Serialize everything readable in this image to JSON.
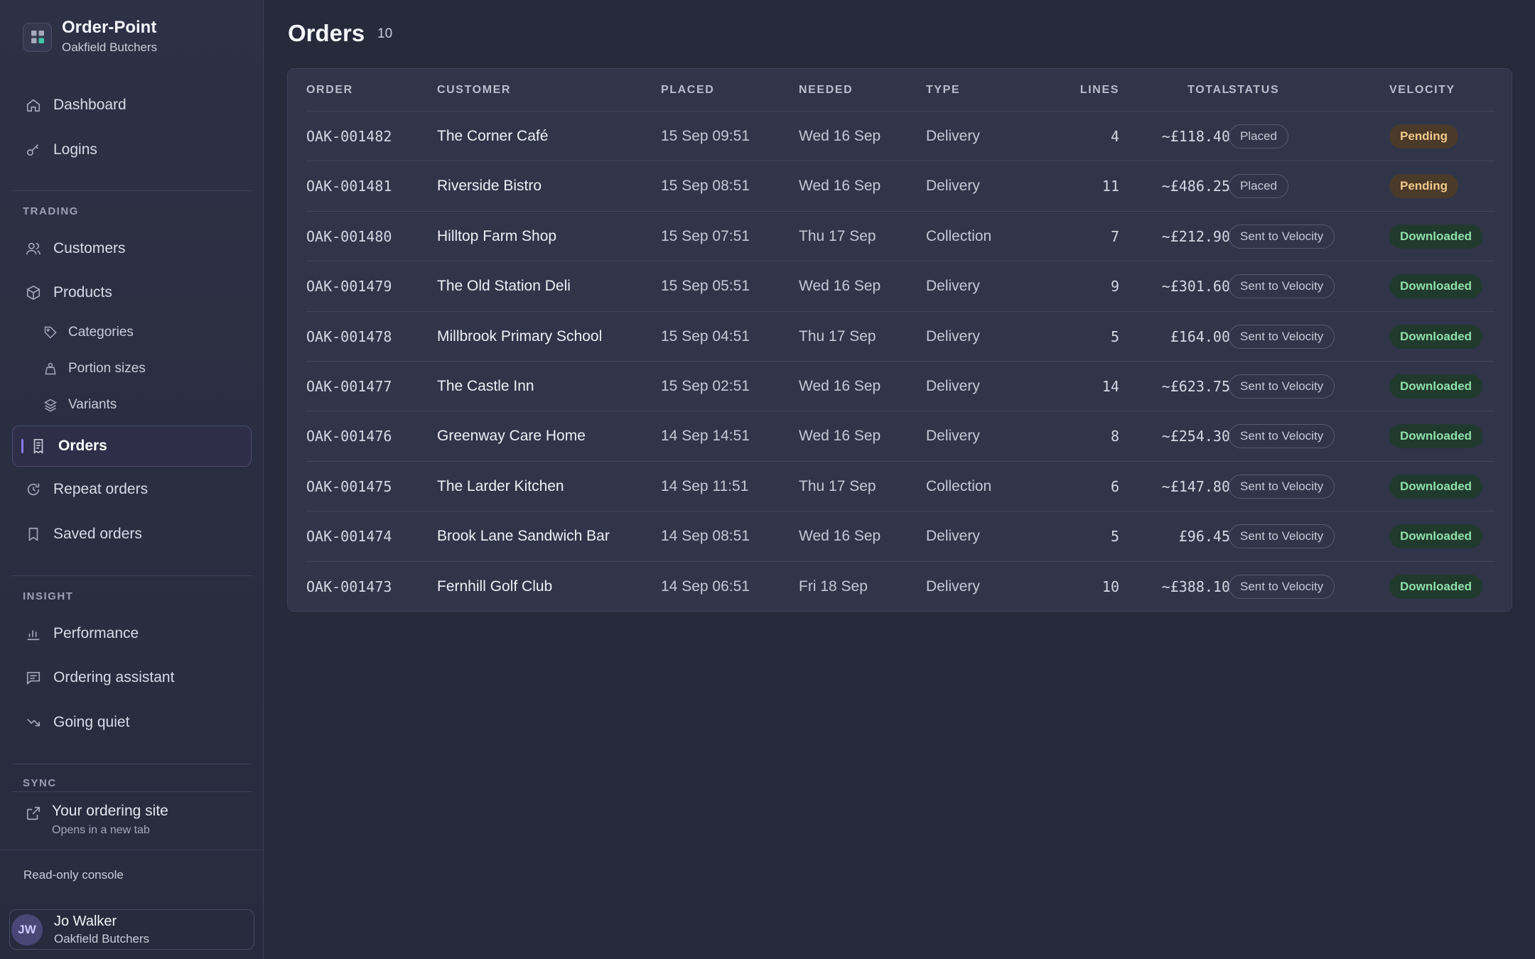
{
  "brand": {
    "name": "Order-Point",
    "sub": "Oakfield Butchers"
  },
  "nav": {
    "dashboard": "Dashboard",
    "logins": "Logins",
    "trading_label": "TRADING",
    "customers": "Customers",
    "products": "Products",
    "categories": "Categories",
    "portion_sizes": "Portion sizes",
    "variants": "Variants",
    "orders": "Orders",
    "repeat_orders": "Repeat orders",
    "saved_orders": "Saved orders",
    "insight_label": "INSIGHT",
    "performance": "Performance",
    "ordering_assistant": "Ordering assistant",
    "going_quiet": "Going quiet",
    "sync_label": "SYNC",
    "ordering_site": "Your ordering site",
    "ordering_site_sub": "Opens in a new tab"
  },
  "footer": {
    "readonly": "Read-only console"
  },
  "user": {
    "initials": "JW",
    "name": "Jo Walker",
    "org": "Oakfield Butchers"
  },
  "page": {
    "title": "Orders",
    "count": "10"
  },
  "table": {
    "headers": {
      "order": "ORDER",
      "customer": "CUSTOMER",
      "placed": "PLACED",
      "needed": "NEEDED",
      "type": "TYPE",
      "lines": "LINES",
      "total": "TOTAL",
      "status": "STATUS",
      "velocity": "VELOCITY"
    },
    "rows": [
      {
        "order": "OAK-001482",
        "customer": "The Corner Café",
        "placed": "15 Sep 09:51",
        "needed": "Wed 16 Sep",
        "type": "Delivery",
        "lines": "4",
        "total": "~£118.40",
        "status": "Placed",
        "velocity": "Pending"
      },
      {
        "order": "OAK-001481",
        "customer": "Riverside Bistro",
        "placed": "15 Sep 08:51",
        "needed": "Wed 16 Sep",
        "type": "Delivery",
        "lines": "11",
        "total": "~£486.25",
        "status": "Placed",
        "velocity": "Pending"
      },
      {
        "order": "OAK-001480",
        "customer": "Hilltop Farm Shop",
        "placed": "15 Sep 07:51",
        "needed": "Thu 17 Sep",
        "type": "Collection",
        "lines": "7",
        "total": "~£212.90",
        "status": "Sent to Velocity",
        "velocity": "Downloaded"
      },
      {
        "order": "OAK-001479",
        "customer": "The Old Station Deli",
        "placed": "15 Sep 05:51",
        "needed": "Wed 16 Sep",
        "type": "Delivery",
        "lines": "9",
        "total": "~£301.60",
        "status": "Sent to Velocity",
        "velocity": "Downloaded"
      },
      {
        "order": "OAK-001478",
        "customer": "Millbrook Primary School",
        "placed": "15 Sep 04:51",
        "needed": "Thu 17 Sep",
        "type": "Delivery",
        "lines": "5",
        "total": "£164.00",
        "status": "Sent to Velocity",
        "velocity": "Downloaded"
      },
      {
        "order": "OAK-001477",
        "customer": "The Castle Inn",
        "placed": "15 Sep 02:51",
        "needed": "Wed 16 Sep",
        "type": "Delivery",
        "lines": "14",
        "total": "~£623.75",
        "status": "Sent to Velocity",
        "velocity": "Downloaded"
      },
      {
        "order": "OAK-001476",
        "customer": "Greenway Care Home",
        "placed": "14 Sep 14:51",
        "needed": "Wed 16 Sep",
        "type": "Delivery",
        "lines": "8",
        "total": "~£254.30",
        "status": "Sent to Velocity",
        "velocity": "Downloaded"
      },
      {
        "order": "OAK-001475",
        "customer": "The Larder Kitchen",
        "placed": "14 Sep 11:51",
        "needed": "Thu 17 Sep",
        "type": "Collection",
        "lines": "6",
        "total": "~£147.80",
        "status": "Sent to Velocity",
        "velocity": "Downloaded"
      },
      {
        "order": "OAK-001474",
        "customer": "Brook Lane Sandwich Bar",
        "placed": "14 Sep 08:51",
        "needed": "Wed 16 Sep",
        "type": "Delivery",
        "lines": "5",
        "total": "£96.45",
        "status": "Sent to Velocity",
        "velocity": "Downloaded"
      },
      {
        "order": "OAK-001473",
        "customer": "Fernhill Golf Club",
        "placed": "14 Sep 06:51",
        "needed": "Fri 18 Sep",
        "type": "Delivery",
        "lines": "10",
        "total": "~£388.10",
        "status": "Sent to Velocity",
        "velocity": "Downloaded"
      }
    ]
  },
  "colors": {
    "accent": "#8b7cf6",
    "pending": "#f2c98a",
    "downloaded": "#8fe0a9"
  }
}
